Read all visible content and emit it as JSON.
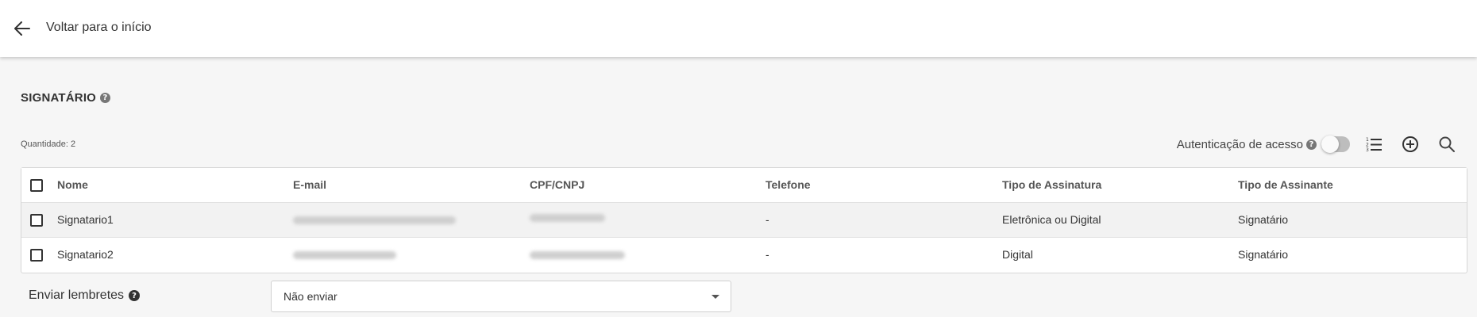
{
  "header": {
    "back_label": "Voltar para o início"
  },
  "section": {
    "title": "SIGNATÁRIO",
    "help": "?"
  },
  "quantity": "Quantidade: 2",
  "toolbar": {
    "auth_label": "Autenticação de acesso",
    "auth_help": "?",
    "auth_enabled": false,
    "icons": [
      "list-numbered-icon",
      "add-circle-icon",
      "search-icon"
    ]
  },
  "table": {
    "columns": [
      "Nome",
      "E-mail",
      "CPF/CNPJ",
      "Telefone",
      "Tipo de Assinatura",
      "Tipo de Assinante"
    ],
    "rows": [
      {
        "nome": "Signatario1",
        "email": "",
        "cpf": "",
        "telefone": "-",
        "tipo_assinatura": "Eletrônica ou Digital",
        "tipo_assinante": "Signatário",
        "checked": false
      },
      {
        "nome": "Signatario2",
        "email": "",
        "cpf": "",
        "telefone": "-",
        "tipo_assinatura": "Digital",
        "tipo_assinante": "Signatário",
        "checked": false
      }
    ]
  },
  "reminder": {
    "label": "Enviar lembretes",
    "help": "?",
    "selected": "Não enviar"
  },
  "colors": {
    "page_bg": "#f6f6f6",
    "row_highlight": "#f2f2f2",
    "toggle_off": "#bdbdbd"
  }
}
